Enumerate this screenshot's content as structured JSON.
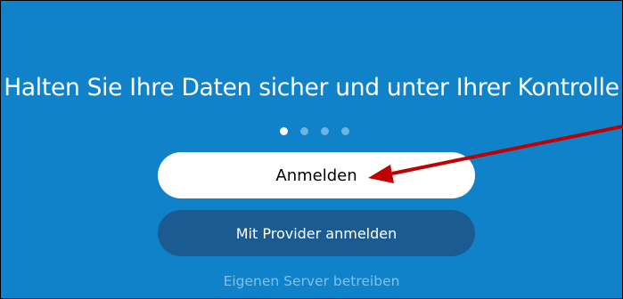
{
  "onboarding": {
    "headline": "Halten Sie Ihre Daten sicher und unter Ihrer Kontrolle",
    "pager": {
      "total": 4,
      "active_index": 0
    }
  },
  "actions": {
    "login_label": "Anmelden",
    "provider_login_label": "Mit Provider anmelden",
    "own_server_label": "Eigenen Server betreiben"
  },
  "annotation": {
    "arrow_color": "#c00000"
  },
  "colors": {
    "background": "#0f82c9",
    "login_button_bg": "#ffffff",
    "provider_button_bg": "#1b5b91",
    "link_text": "#7fc1ea"
  }
}
